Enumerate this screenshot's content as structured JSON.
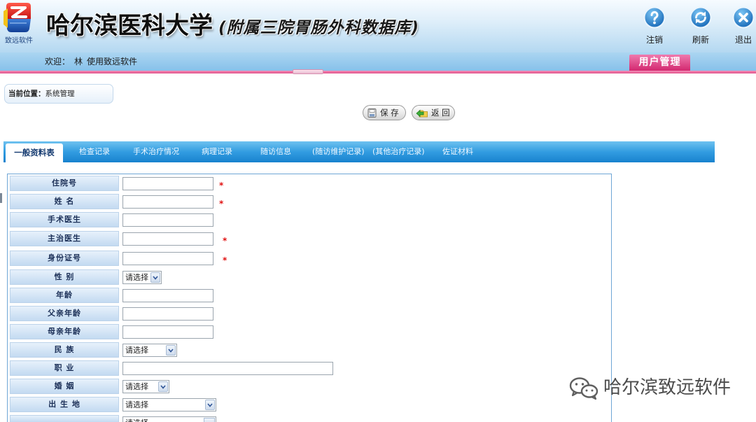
{
  "header": {
    "logo_text": "致远软件",
    "title": "哈尔滨医科大学",
    "subtitle": "(附属三院胃肠外科数据库)",
    "actions": [
      {
        "label": "注销",
        "icon": "help-icon"
      },
      {
        "label": "刷新",
        "icon": "refresh-icon"
      },
      {
        "label": "退出",
        "icon": "close-icon"
      }
    ]
  },
  "welcome": {
    "prefix": "欢迎：",
    "user": "林",
    "suffix": "使用致远软件"
  },
  "user_menu": {
    "label": "用户管理"
  },
  "breadcrumb": {
    "label": "当前位置：",
    "value": "系统管理"
  },
  "toolbar": {
    "save_label": "保 存",
    "back_label": "返 回",
    "save_icon": "save-icon",
    "back_icon": "back-icon"
  },
  "tabs": [
    {
      "label": "一般资料表",
      "active": true
    },
    {
      "label": "检查记录",
      "active": false
    },
    {
      "label": "手术治疗情况",
      "active": false
    },
    {
      "label": "病理记录",
      "active": false
    },
    {
      "label": "随访信息",
      "active": false
    },
    {
      "label": "(随访维护记录)",
      "active": false
    },
    {
      "label": "(其他治疗记录)",
      "active": false
    },
    {
      "label": "佐证材料",
      "active": false
    }
  ],
  "form": {
    "required_mark": "*",
    "rows": [
      {
        "label": "住院号",
        "value": "",
        "required": true
      },
      {
        "label": "姓 名",
        "value": "",
        "required": true
      },
      {
        "label": "手术医生",
        "value": "",
        "required": false
      },
      {
        "label": "主治医生",
        "value": "",
        "required": true
      },
      {
        "label": "身份证号",
        "value": "",
        "required": true
      },
      {
        "label": "性 别",
        "selected": "请选择",
        "required": false
      },
      {
        "label": "年龄",
        "value": "",
        "required": false
      },
      {
        "label": "父亲年龄",
        "value": "",
        "required": false
      },
      {
        "label": "母亲年龄",
        "value": "",
        "required": false
      },
      {
        "label": "民 族",
        "selected": "请选择",
        "required": false
      },
      {
        "label": "职 业",
        "value": "",
        "required": false
      },
      {
        "label": "婚 姻",
        "selected": "请选择",
        "required": false
      },
      {
        "label": "出 生 地",
        "selected": "请选择",
        "required": false
      },
      {
        "selected": "请选择",
        "required": false
      }
    ]
  },
  "watermark": {
    "text": "哈尔滨致远软件",
    "icon": "wechat-icon"
  },
  "colors": {
    "header_bg": "#b4d8f1",
    "welcome_bar": "#87c1ea",
    "accent_blue": "#1882ce",
    "user_tab": "#d3286f",
    "pink_line": "#e2508a",
    "label_bg": "#c3daf1",
    "required": "#e01010"
  }
}
